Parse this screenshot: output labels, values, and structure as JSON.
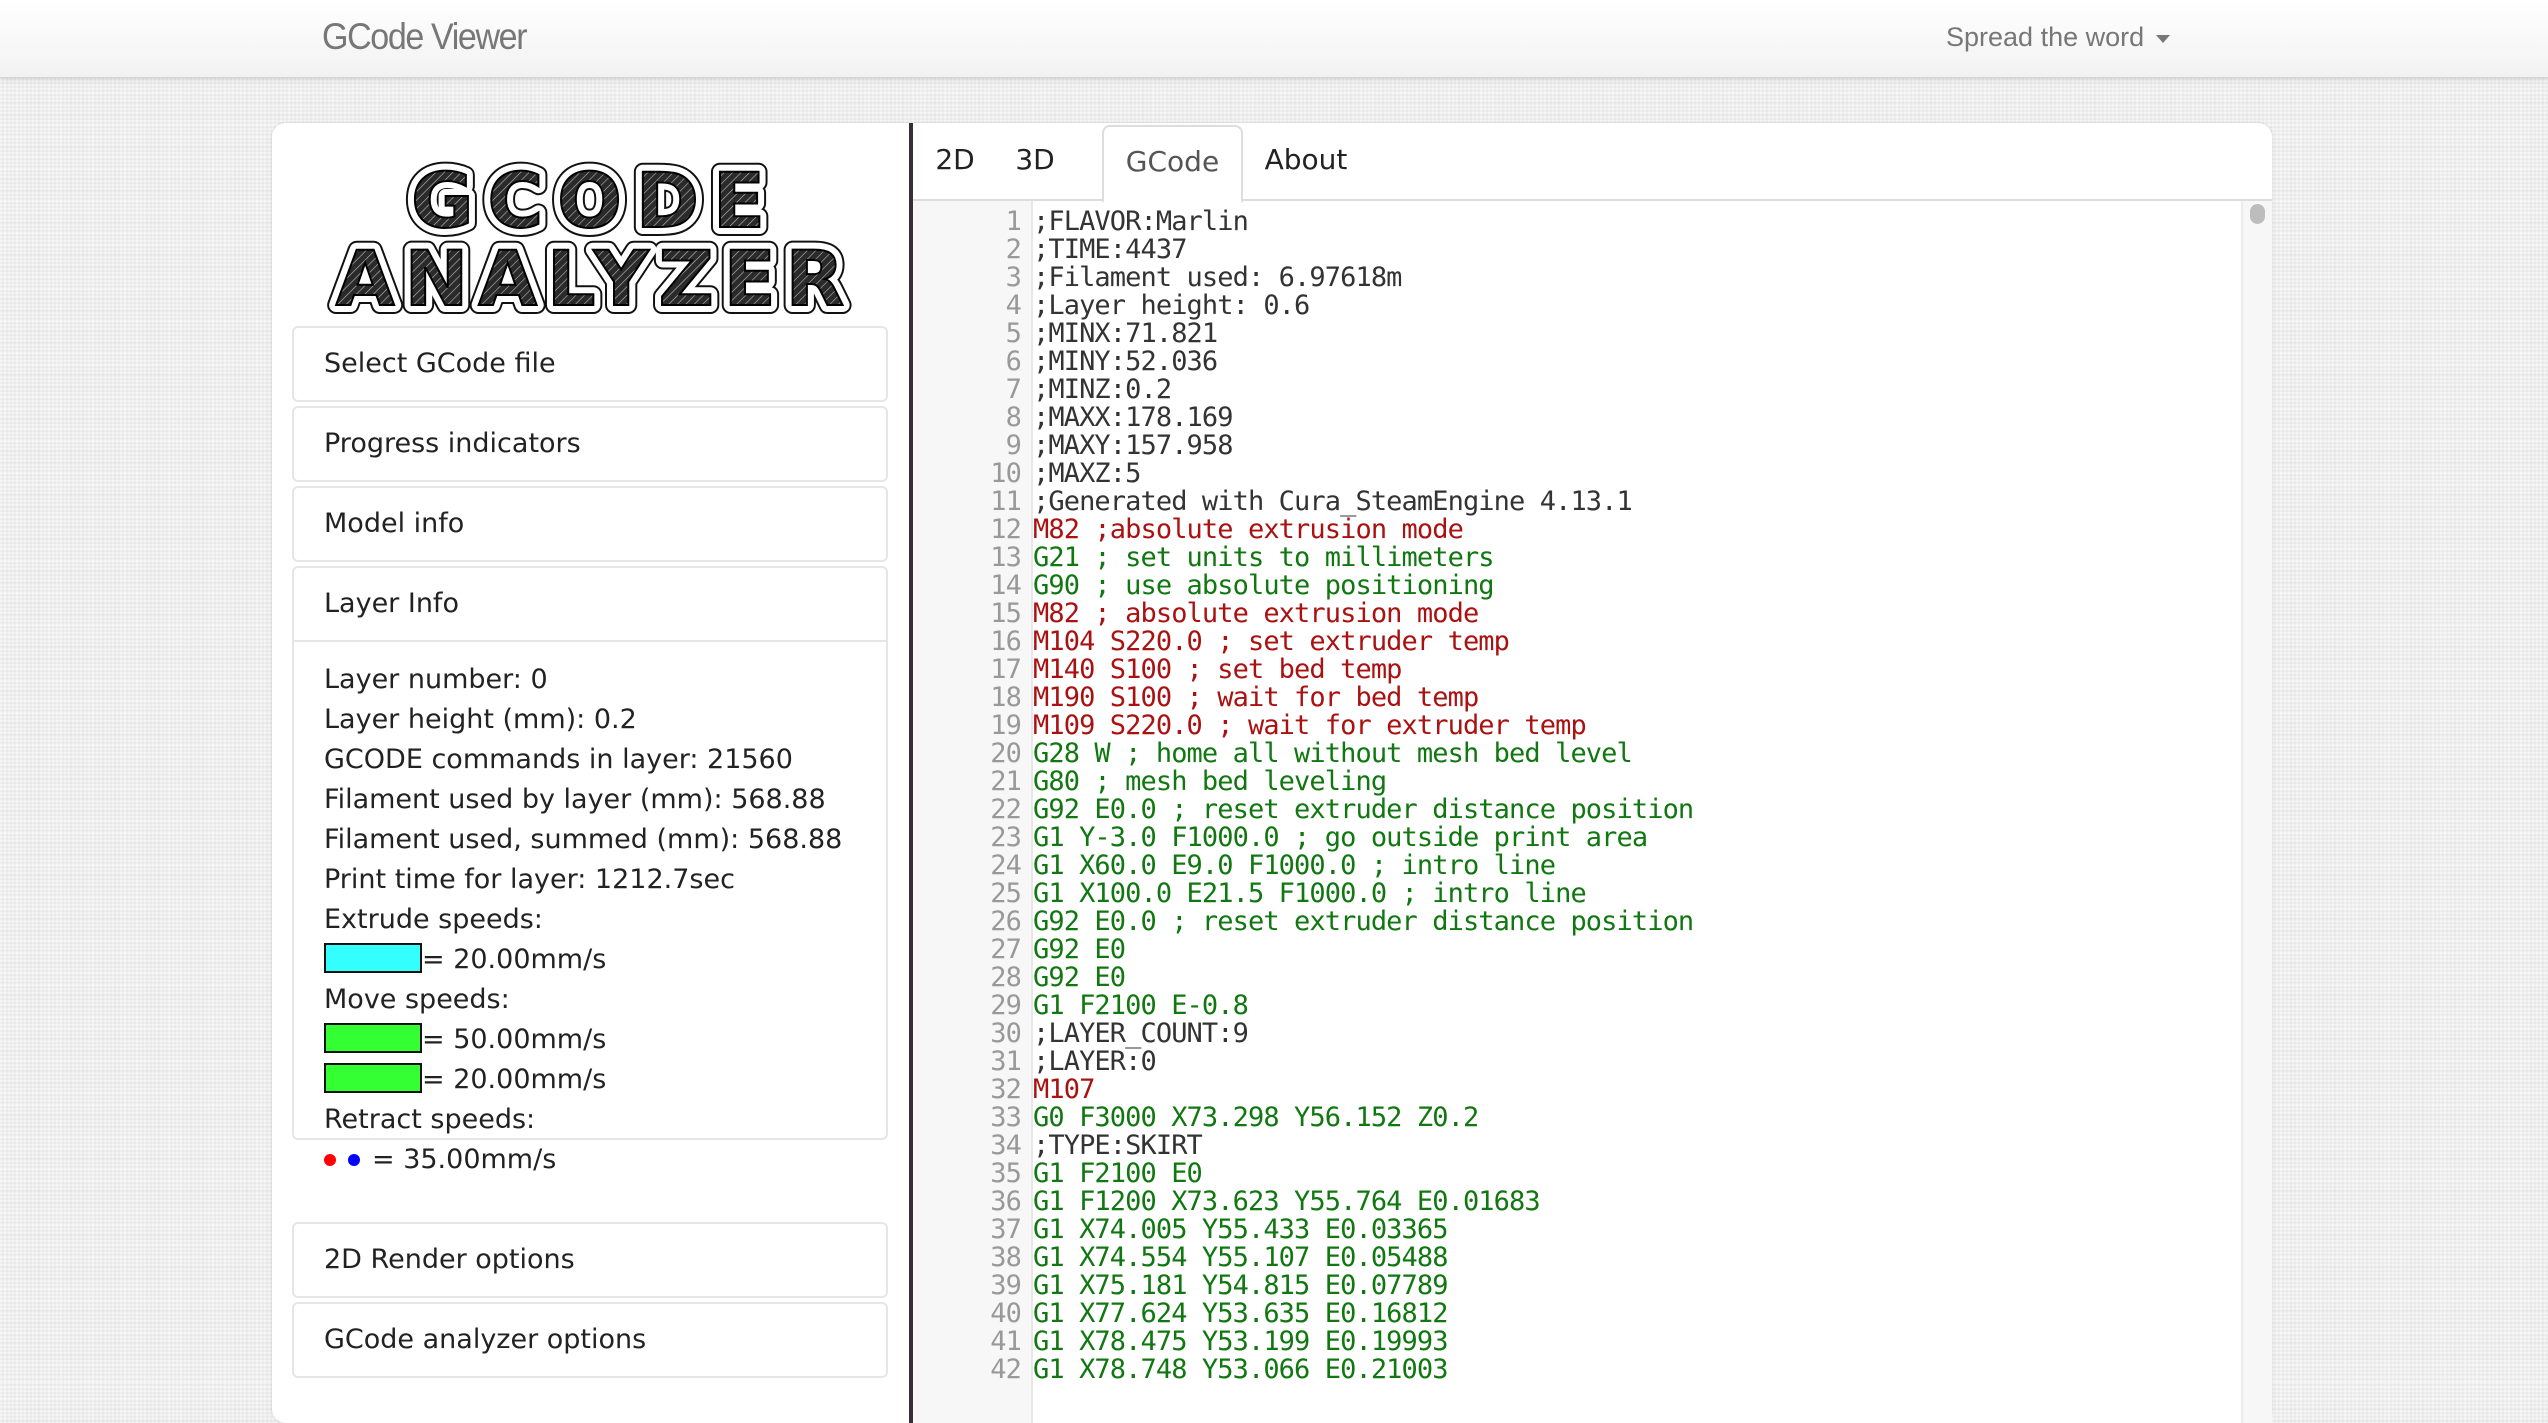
{
  "navbar": {
    "brand": "GCode Viewer",
    "spread_label": "Spread the word"
  },
  "logo": {
    "line1": "GCODE",
    "line2": "ANALYZER"
  },
  "sidebar": {
    "panels": [
      {
        "label": "Select GCode file"
      },
      {
        "label": "Progress indicators"
      },
      {
        "label": "Model info"
      },
      {
        "label": "Layer Info"
      },
      {
        "label": "2D Render options"
      },
      {
        "label": "GCode analyzer options"
      }
    ],
    "layer_info": {
      "layer_number": "Layer number: 0",
      "layer_height": "Layer height (mm): 0.2",
      "commands": "GCODE commands in layer: 21560",
      "filament_layer": "Filament used by layer (mm): 568.88",
      "filament_summed": "Filament used, summed (mm): 568.88",
      "print_time": "Print time for layer: 1212.7sec",
      "extrude_label": "Extrude speeds:",
      "extrude_speeds": [
        {
          "color": "#33ffff",
          "value": "= 20.00mm/s"
        }
      ],
      "move_label": "Move speeds:",
      "move_speeds": [
        {
          "color": "#33ff33",
          "value": "= 50.00mm/s"
        },
        {
          "color": "#33ff33",
          "value": "= 20.00mm/s"
        }
      ],
      "retract_label": "Retract speeds:",
      "retract_colors": [
        "#ff0000",
        "#0000ff"
      ],
      "retract_value": "= 35.00mm/s"
    }
  },
  "tabs": [
    {
      "label": "2D",
      "active": false
    },
    {
      "label": "3D",
      "active": false
    },
    {
      "label": "GCode",
      "active": true
    },
    {
      "label": "About",
      "active": false
    }
  ],
  "colors": {
    "comment": "#333333",
    "mcode": "#aa1111",
    "gcode": "#117711",
    "line_number": "#999999"
  },
  "gcode_lines": [
    {
      "n": "1",
      "t": ";FLAVOR:Marlin",
      "k": "comment"
    },
    {
      "n": "2",
      "t": ";TIME:4437",
      "k": "comment"
    },
    {
      "n": "3",
      "t": ";Filament used: 6.97618m",
      "k": "comment"
    },
    {
      "n": "4",
      "t": ";Layer height: 0.6",
      "k": "comment"
    },
    {
      "n": "5",
      "t": ";MINX:71.821",
      "k": "comment"
    },
    {
      "n": "6",
      "t": ";MINY:52.036",
      "k": "comment"
    },
    {
      "n": "7",
      "t": ";MINZ:0.2",
      "k": "comment"
    },
    {
      "n": "8",
      "t": ";MAXX:178.169",
      "k": "comment"
    },
    {
      "n": "9",
      "t": ";MAXY:157.958",
      "k": "comment"
    },
    {
      "n": "10",
      "t": ";MAXZ:5",
      "k": "comment"
    },
    {
      "n": "11",
      "t": ";Generated with Cura_SteamEngine 4.13.1",
      "k": "comment"
    },
    {
      "n": "12",
      "t": "M82 ;absolute extrusion mode",
      "k": "red"
    },
    {
      "n": "13",
      "t": "G21 ; set units to millimeters",
      "k": "green"
    },
    {
      "n": "14",
      "t": "G90 ; use absolute positioning",
      "k": "green"
    },
    {
      "n": "15",
      "t": "M82 ; absolute extrusion mode",
      "k": "red"
    },
    {
      "n": "16",
      "t": "M104 S220.0 ; set extruder temp",
      "k": "red"
    },
    {
      "n": "17",
      "t": "M140 S100 ; set bed temp",
      "k": "red"
    },
    {
      "n": "18",
      "t": "M190 S100 ; wait for bed temp",
      "k": "red"
    },
    {
      "n": "19",
      "t": "M109 S220.0 ; wait for extruder temp",
      "k": "red"
    },
    {
      "n": "20",
      "t": "G28 W ; home all without mesh bed level",
      "k": "green"
    },
    {
      "n": "21",
      "t": "G80 ; mesh bed leveling",
      "k": "green"
    },
    {
      "n": "22",
      "t": "G92 E0.0 ; reset extruder distance position",
      "k": "green"
    },
    {
      "n": "23",
      "t": "G1 Y-3.0 F1000.0 ; go outside print area",
      "k": "green"
    },
    {
      "n": "24",
      "t": "G1 X60.0 E9.0 F1000.0 ; intro line",
      "k": "green"
    },
    {
      "n": "25",
      "t": "G1 X100.0 E21.5 F1000.0 ; intro line",
      "k": "green"
    },
    {
      "n": "26",
      "t": "G92 E0.0 ; reset extruder distance position",
      "k": "green"
    },
    {
      "n": "27",
      "t": "G92 E0",
      "k": "green"
    },
    {
      "n": "28",
      "t": "G92 E0",
      "k": "green"
    },
    {
      "n": "29",
      "t": "G1 F2100 E-0.8",
      "k": "green"
    },
    {
      "n": "30",
      "t": ";LAYER_COUNT:9",
      "k": "comment"
    },
    {
      "n": "31",
      "t": ";LAYER:0",
      "k": "comment"
    },
    {
      "n": "32",
      "t": "M107",
      "k": "red"
    },
    {
      "n": "33",
      "t": "G0 F3000 X73.298 Y56.152 Z0.2",
      "k": "green"
    },
    {
      "n": "34",
      "t": ";TYPE:SKIRT",
      "k": "comment"
    },
    {
      "n": "35",
      "t": "G1 F2100 E0",
      "k": "green"
    },
    {
      "n": "36",
      "t": "G1 F1200 X73.623 Y55.764 E0.01683",
      "k": "green"
    },
    {
      "n": "37",
      "t": "G1 X74.005 Y55.433 E0.03365",
      "k": "green"
    },
    {
      "n": "38",
      "t": "G1 X74.554 Y55.107 E0.05488",
      "k": "green"
    },
    {
      "n": "39",
      "t": "G1 X75.181 Y54.815 E0.07789",
      "k": "green"
    },
    {
      "n": "40",
      "t": "G1 X77.624 Y53.635 E0.16812",
      "k": "green"
    },
    {
      "n": "41",
      "t": "G1 X78.475 Y53.199 E0.19993",
      "k": "green"
    },
    {
      "n": "42",
      "t": "G1 X78.748 Y53.066 E0.21003",
      "k": "green"
    }
  ]
}
